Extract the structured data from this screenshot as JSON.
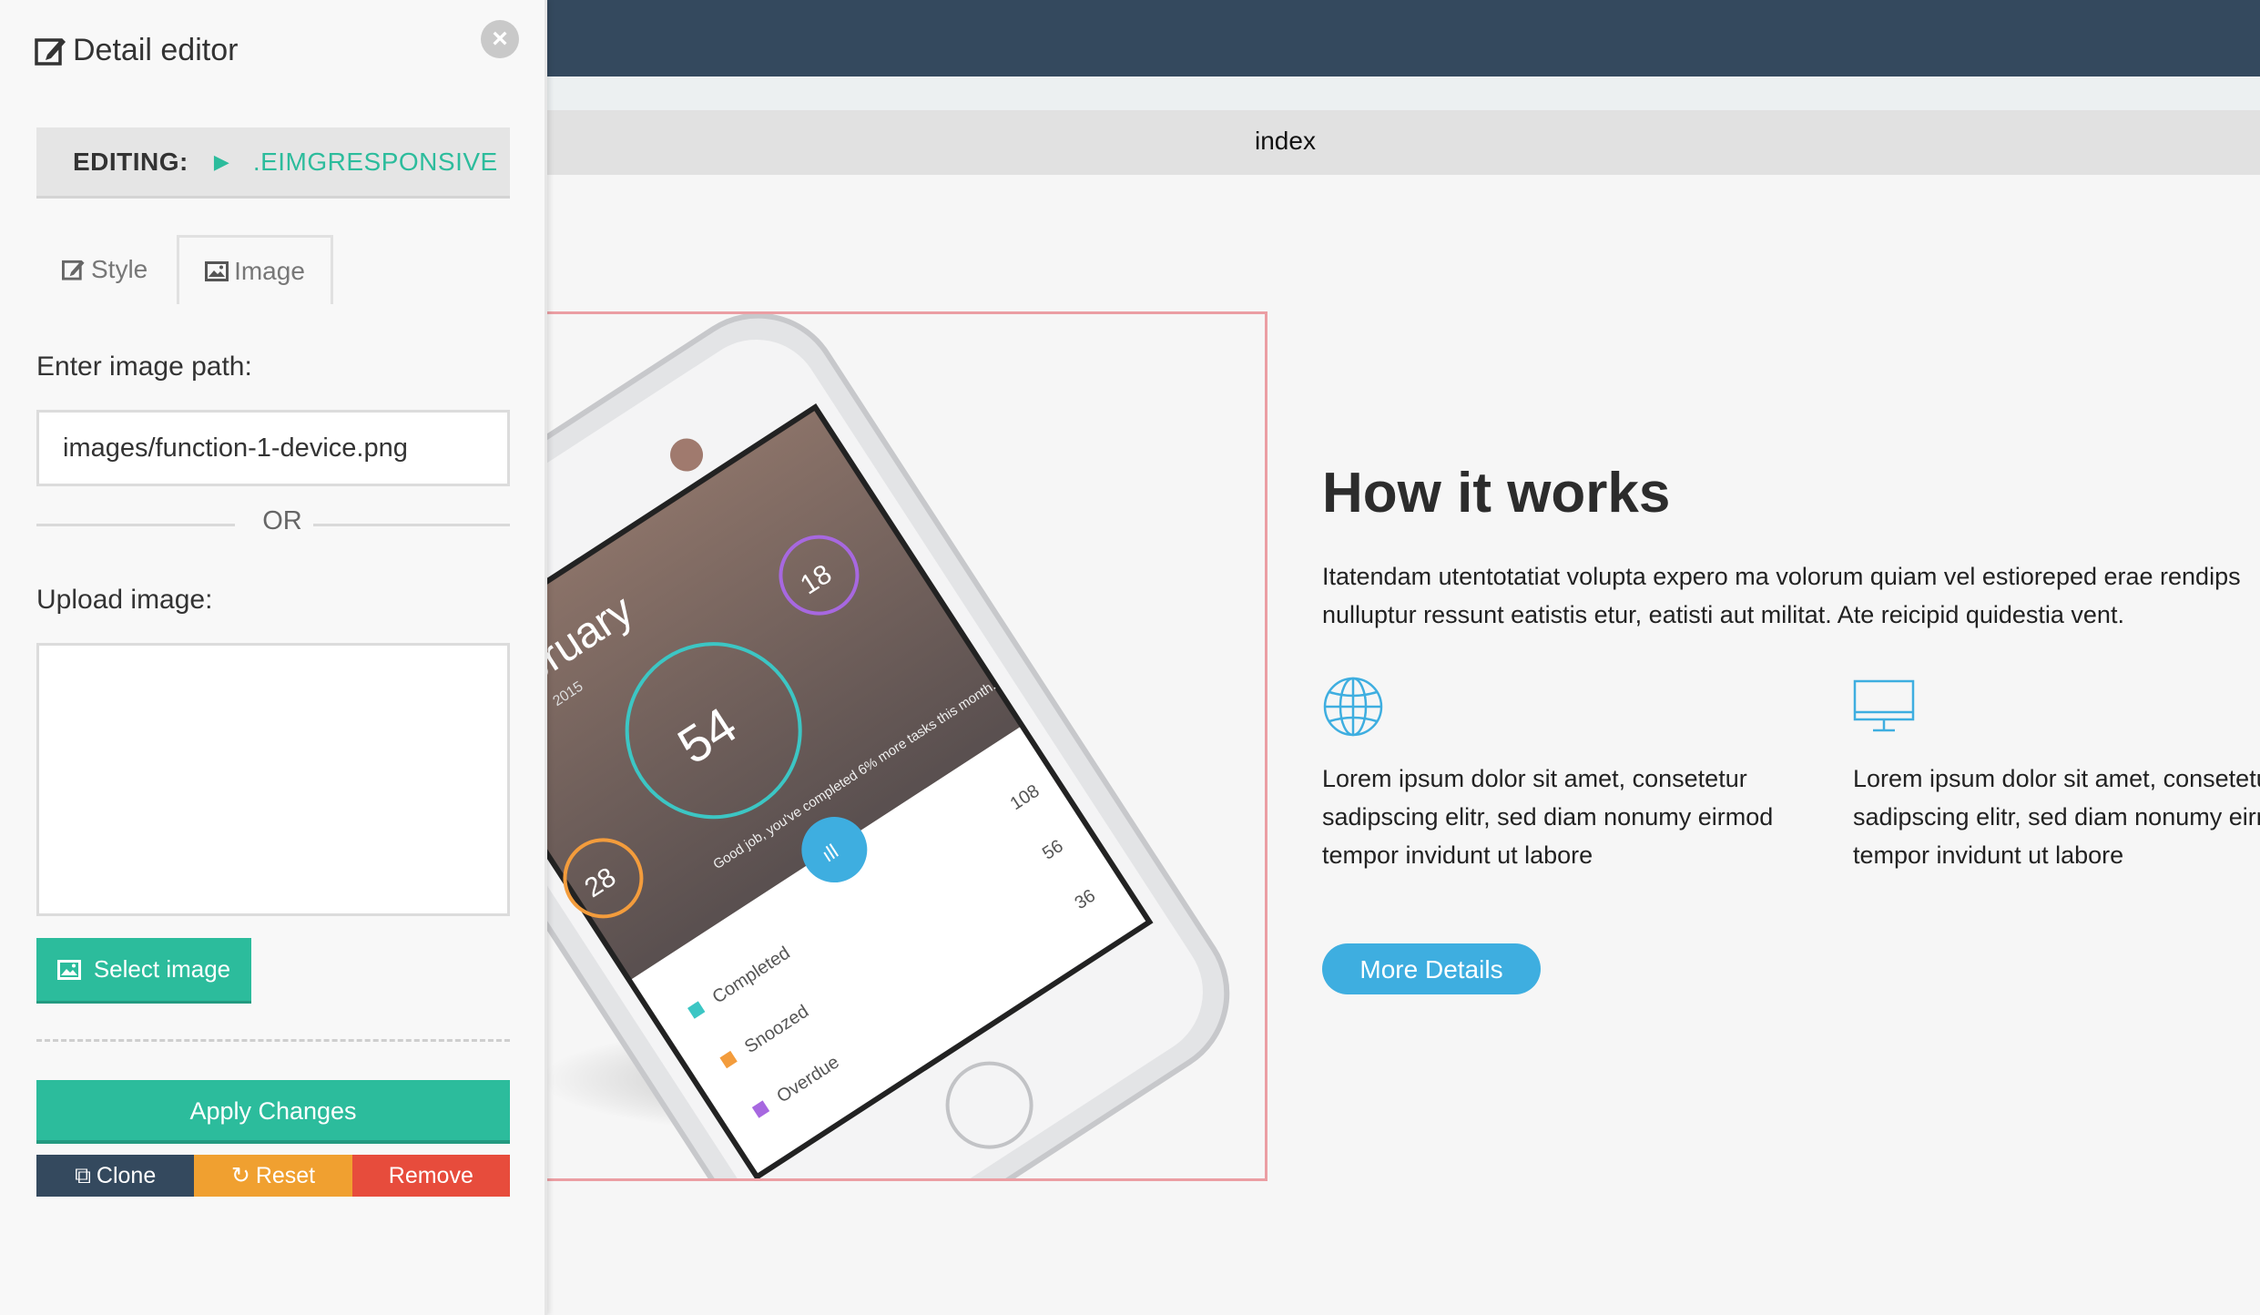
{
  "preview": {
    "page_tab": "index",
    "section_title": "How it works",
    "section_desc": "Itatendam utentotatiat volupta expero ma volorum quiam vel estioreped erae rendips nulluptur ressunt eatistis etur, eatisti aut militat. Ate reicipid quidestia vent.",
    "features": [
      {
        "icon": "globe-icon",
        "text": "Lorem ipsum dolor sit amet, consetetur sadipscing elitr, sed diam nonumy eirmod tempor invidunt ut labore"
      },
      {
        "icon": "monitor-icon",
        "text": "Lorem ipsum dolor sit amet, consetetur sadipscing elitr, sed diam nonumy eirmod tempor invidunt ut labore"
      }
    ],
    "more_button": "More Details",
    "phone": {
      "month": "bruary",
      "year": "2015",
      "main_percent": "54",
      "left_percent": "28",
      "right_percent": "18",
      "message": "Good job, you've completed 6% more tasks this month.",
      "stats": [
        {
          "label": "Completed",
          "value": "108",
          "color": "#3cc6c4"
        },
        {
          "label": "Snoozed",
          "value": "56",
          "color": "#f39c3c"
        },
        {
          "label": "Overdue",
          "value": "36",
          "color": "#a768e0"
        }
      ]
    }
  },
  "editor": {
    "title": "Detail editor",
    "close_icon": "close-icon",
    "editing_label": "EDITING:",
    "editing_target": ".EIMGRESPONSIVE",
    "tabs": [
      {
        "label": "Style",
        "icon": "edit-icon",
        "active": false
      },
      {
        "label": "Image",
        "icon": "image-icon",
        "active": true
      }
    ],
    "image_path_label": "Enter image path:",
    "image_path_value": "images/function-1-device.png",
    "or_text": "OR",
    "upload_label": "Upload image:",
    "select_image_button": "Select image",
    "apply_button": "Apply Changes",
    "clone_button": "Clone",
    "reset_button": "Reset",
    "remove_button": "Remove"
  },
  "colors": {
    "accent": "#2cbc9c",
    "top_bar": "#34495e",
    "more_button": "#3eaee0",
    "reset": "#f0a030",
    "remove": "#e74c3c"
  }
}
